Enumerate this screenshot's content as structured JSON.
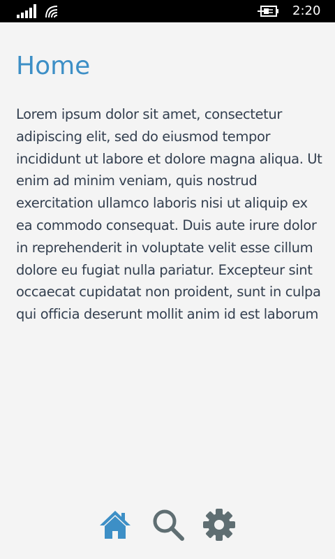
{
  "status_bar": {
    "time": "2:20"
  },
  "page": {
    "title": "Home",
    "body": "Lorem ipsum dolor sit amet, consectetur adipiscing elit, sed do eiusmod tempor incididunt ut labore et dolore magna aliqua. Ut enim ad minim veniam, quis nostrud exercitation ullamco laboris nisi ut aliquip ex ea commodo consequat. Duis aute irure dolor in reprehenderit in voluptate velit esse cillum dolore eu fugiat nulla pariatur. Excepteur sint occaecat cupidatat non proident, sunt in culpa qui officia deserunt mollit anim id est laborum"
  },
  "nav": {
    "items": [
      {
        "icon": "home-icon",
        "active": true
      },
      {
        "icon": "search-icon",
        "active": false
      },
      {
        "icon": "gear-icon",
        "active": false
      }
    ]
  },
  "colors": {
    "accent": "#3d8fc6",
    "icon_inactive": "#5f6e72",
    "text": "#333f4f",
    "background": "#f4f4f4",
    "status_bar": "#000000"
  }
}
